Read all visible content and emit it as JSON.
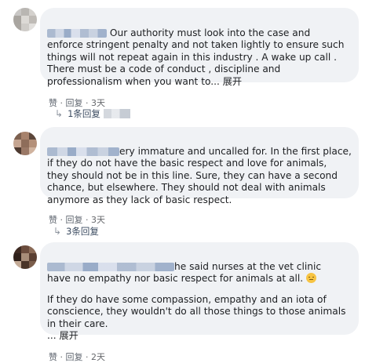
{
  "comments": [
    {
      "lines": [
        "Our authority must look into the case and",
        "enforce stringent penalty and not taken lightly to ensure such",
        "things will not repeat again in this industry . A wake up call .",
        "There must be a code of conduct , discipline and",
        "professionalism when you want to... "
      ],
      "see_more": "展开",
      "like": "赞",
      "sep": " · ",
      "reply": "回复",
      "time": "3天",
      "replies_label": "1条回复",
      "avatar_colors": [
        "#c9c7c5",
        "#b9b6b2",
        "#d4d1cd",
        "#a9a5a0",
        "#dcd9d5",
        "#bfbbb6",
        "#aaa6a1",
        "#cfccc8",
        "#e2e0dd"
      ]
    },
    {
      "lines": [
        "ery immature and uncalled for. In the first place,",
        "if they do not have the basic respect and love for animals,",
        "they should not be in this line. Sure, they can have a second",
        "chance, but elsewhere. They should not deal with animals",
        "anymore as they lack of basic respect."
      ],
      "like": "赞",
      "sep": " · ",
      "reply": "回复",
      "time": "3天",
      "replies_label": "3条回复",
      "avatar_colors": [
        "#7d6150",
        "#a7826c",
        "#5c463a",
        "#c5a591",
        "#8e6d5a",
        "#b49079",
        "#4e3a30",
        "#9a7866",
        "#d0b39f"
      ]
    },
    {
      "lines": [
        "he said nurses at the vet clinic",
        "have no empathy nor basic respect for animals at all. "
      ],
      "lines2": [
        "If they do have some compassion, empathy and an iota of",
        "conscience, they wouldn't do all those things to those animals",
        "in their care.",
        "... "
      ],
      "see_more": "展开",
      "like": "赞",
      "sep": " · ",
      "reply": "回复",
      "time": "2天",
      "avatar_colors": [
        "#3e2a22",
        "#6b4c3d",
        "#8a6a56",
        "#2f201a",
        "#a78c78",
        "#5a3f32",
        "#c4ab97",
        "#4a3428",
        "#7b5d4b"
      ]
    }
  ]
}
